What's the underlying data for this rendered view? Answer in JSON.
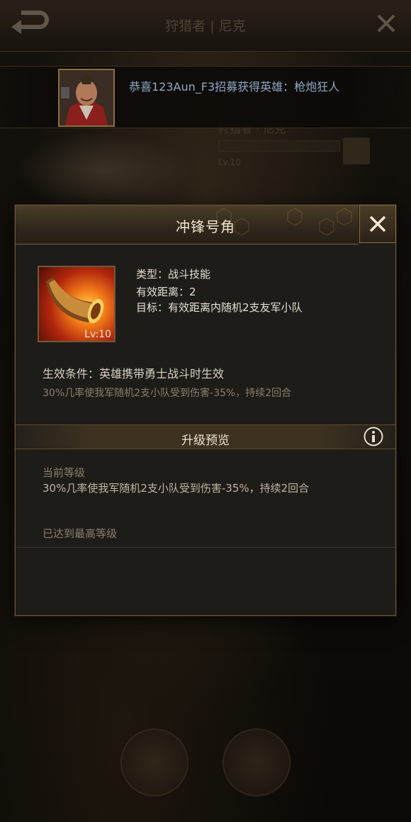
{
  "background": {
    "title": "狩猎者 | 尼克",
    "hero_name": "狩猎者 · 尼克",
    "hero_level": "Lv.10"
  },
  "notification": {
    "text": "恭喜123Aun_F3招募获得英雄：枪炮狂人"
  },
  "dialog": {
    "title": "冲锋号角",
    "skill_level": "Lv:10",
    "type_line": "类型：战斗技能",
    "range_line": "有效距离：2",
    "target_line": "目标：有效距离内随机2支友军小队",
    "condition": "生效条件：英雄携带勇士战斗时生效",
    "description": "30%几率使我军随机2支小队受到伤害-35%，持续2回合",
    "upgrade_title": "升级预览",
    "current_level_label": "当前等级",
    "current_level_desc": "30%几率使我军随机2支小队受到伤害-35%，持续2回合",
    "max_level_text": "已达到最高等级"
  },
  "colors": {
    "accent_gold": "#8c6d3e",
    "notify_text": "#8ea7c9"
  }
}
